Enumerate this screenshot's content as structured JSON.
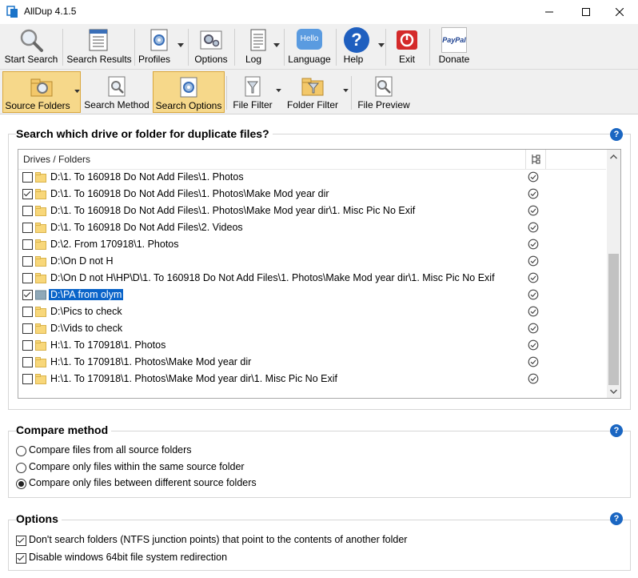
{
  "window": {
    "title": "AllDup 4.1.5"
  },
  "toolbar_main": [
    {
      "id": "start-search",
      "label": "Start Search"
    },
    {
      "id": "search-results",
      "label": "Search Results"
    },
    {
      "id": "profiles",
      "label": "Profiles"
    },
    {
      "id": "options",
      "label": "Options"
    },
    {
      "id": "log",
      "label": "Log"
    },
    {
      "id": "language",
      "label": "Language",
      "icon_text": "Hello"
    },
    {
      "id": "help",
      "label": "Help"
    },
    {
      "id": "exit",
      "label": "Exit"
    },
    {
      "id": "donate",
      "label": "Donate",
      "icon_text": "PayPal"
    }
  ],
  "toolbar_secondary": [
    {
      "id": "source-folders",
      "label": "Source Folders",
      "active": true
    },
    {
      "id": "search-method",
      "label": "Search Method",
      "active": false
    },
    {
      "id": "search-options",
      "label": "Search Options",
      "active": true
    },
    {
      "id": "file-filter",
      "label": "File Filter",
      "active": false
    },
    {
      "id": "folder-filter",
      "label": "Folder Filter",
      "active": false
    },
    {
      "id": "file-preview",
      "label": "File Preview",
      "active": false
    }
  ],
  "source_section": {
    "title": "Search which drive or folder for duplicate files?",
    "list_header": "Drives / Folders",
    "rows": [
      {
        "path": "D:\\1. To 160918 Do Not Add Files\\1. Photos",
        "checked": false,
        "selected": false
      },
      {
        "path": "D:\\1. To 160918 Do Not Add Files\\1. Photos\\Make Mod  year dir",
        "checked": true,
        "selected": false
      },
      {
        "path": "D:\\1. To 160918 Do Not Add Files\\1. Photos\\Make Mod  year dir\\1. Misc Pic No Exif",
        "checked": false,
        "selected": false
      },
      {
        "path": "D:\\1. To 160918 Do Not Add Files\\2. Videos",
        "checked": false,
        "selected": false
      },
      {
        "path": "D:\\2. From 170918\\1. Photos",
        "checked": false,
        "selected": false
      },
      {
        "path": "D:\\On D not H",
        "checked": false,
        "selected": false
      },
      {
        "path": "D:\\On D not H\\HP\\D\\1. To 160918 Do Not Add Files\\1. Photos\\Make Mod  year dir\\1. Misc Pic No Exif",
        "checked": false,
        "selected": false
      },
      {
        "path": "D:\\PA from olym",
        "checked": true,
        "selected": true
      },
      {
        "path": "D:\\Pics to check",
        "checked": false,
        "selected": false
      },
      {
        "path": "D:\\Vids to check",
        "checked": false,
        "selected": false
      },
      {
        "path": "H:\\1. To 170918\\1. Photos",
        "checked": false,
        "selected": false
      },
      {
        "path": "H:\\1. To 170918\\1. Photos\\Make Mod  year dir",
        "checked": false,
        "selected": false
      },
      {
        "path": "H:\\1. To 170918\\1. Photos\\Make Mod  year dir\\1. Misc Pic No Exif",
        "checked": false,
        "selected": false
      }
    ]
  },
  "compare_section": {
    "title": "Compare method",
    "options": [
      {
        "label": "Compare files from all source folders",
        "selected": false
      },
      {
        "label": "Compare only files within the same source folder",
        "selected": false
      },
      {
        "label": "Compare only files between different source folders",
        "selected": true
      }
    ]
  },
  "options_section": {
    "title": "Options",
    "options": [
      {
        "label": "Don't search folders (NTFS junction points) that point to the contents of another folder",
        "checked": true
      },
      {
        "label": "Disable windows 64bit file system redirection",
        "checked": true
      }
    ]
  },
  "help_glyph": "?",
  "colors": {
    "accent_selected": "#0a64c9",
    "active_tab": "#f6d88a",
    "help_blue": "#1a66c2",
    "exit_red": "#d42a2a"
  }
}
